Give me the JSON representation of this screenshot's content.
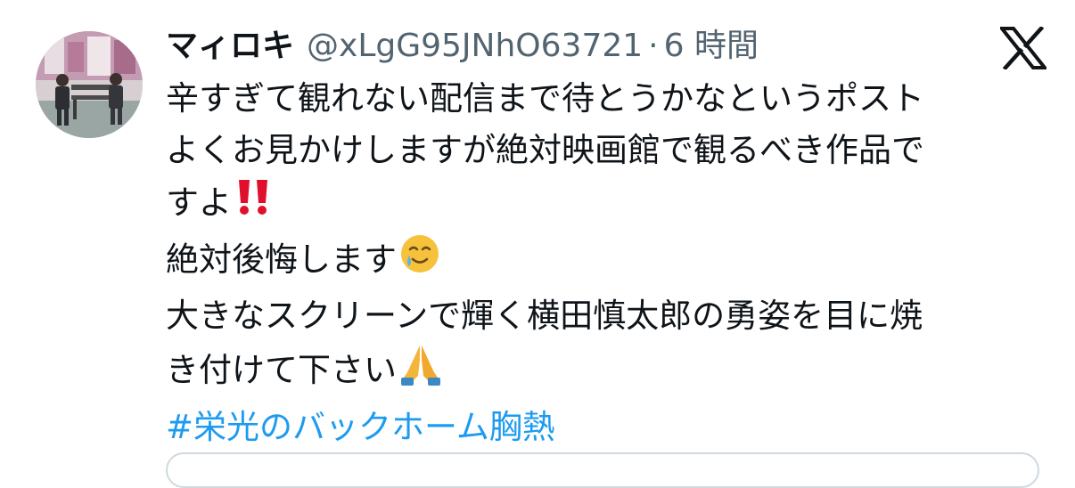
{
  "tweet": {
    "display_name": "マィロキ",
    "handle": "@xLgG95JNhO63721",
    "separator": "·",
    "time": "6 時間",
    "lines": [
      "辛すぎて観れない配信まで待とうかなというポスト",
      "よくお見かけしますが絶対映画館で観るべき作品で",
      "すよ",
      "絶対後悔します",
      "大きなスクリーンで輝く横田慎太郎の勇姿を目に焼",
      "き付けて下さい"
    ],
    "hashtag": "#栄光のバックホーム胸熱"
  },
  "icons": {
    "platform": "x-logo-icon",
    "emoji_1": "double-exclamation-icon",
    "emoji_2": "smiling-face-with-tear-icon",
    "emoji_3": "folded-hands-icon"
  },
  "colors": {
    "text": "#0f1419",
    "secondary": "#536471",
    "link": "#1d9bf0",
    "exclamation": "#e0102c"
  }
}
